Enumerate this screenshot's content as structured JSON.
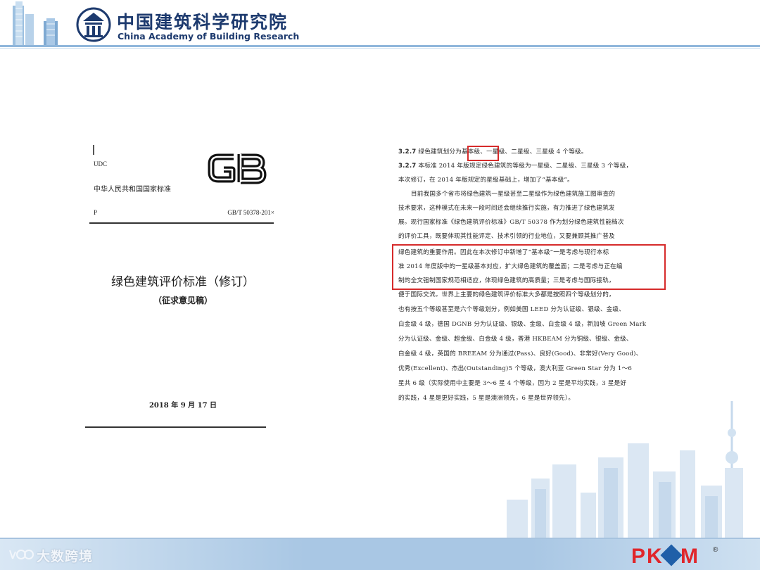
{
  "header": {
    "org_name_cn": "中国建筑科学研究院",
    "org_name_en": "China Academy of Building Research"
  },
  "cover": {
    "udc": "UDC",
    "logo_text": "GB",
    "national_standard": "中华人民共和国国家标准",
    "p": "P",
    "standard_number": "GB/T 50378-201×",
    "title": "绿色建筑评价标准（修订）",
    "subtitle": "（征求意见稿）",
    "date": "2018 年 9 月 17 日"
  },
  "text_page": {
    "lines": [
      {
        "prefix": "3.2.7",
        "text": "  绿色建筑划分为基本级、一星级、二星级、三星级 4 个等级。",
        "indent": false
      },
      {
        "prefix": "3.2.7",
        "text": " 本标准 2014 年版规定绿色建筑的等级为一星级、二星级、三星级 3 个等级，",
        "indent": false
      },
      {
        "prefix": "",
        "text": "本次修订，在 2014 年版规定的星级基础上，增加了“基本级”。",
        "indent": false
      },
      {
        "prefix": "",
        "text": "目前我国多个省市将绿色建筑一星级甚至二星级作为绿色建筑施工图审查的",
        "indent": true
      },
      {
        "prefix": "",
        "text": "技术要求，这种模式在未来一段时间还会继续推行实施，有力推进了绿色建筑发",
        "indent": false
      },
      {
        "prefix": "",
        "text": "展。现行国家标准《绿色建筑评价标准》GB/T 50378 作为划分绿色建筑性能档次",
        "indent": false
      },
      {
        "prefix": "",
        "text": "的评价工具，既要体现其性能评定、技术引领的行业地位，又要兼顾其推广普及",
        "indent": false
      },
      {
        "prefix": "",
        "text": "绿色建筑的重要作用。因此在本次修订中新增了“基本级”一是考虑与现行本标",
        "indent": false
      },
      {
        "prefix": "",
        "text": "准 2014 年度版中的一星级基本对应，扩大绿色建筑的覆盖面；二是考虑与正在编",
        "indent": false
      },
      {
        "prefix": "",
        "text": "制的全文强制国家规范相适应，体现绿色建筑的高质量；三是考虑与国际接轨，",
        "indent": false
      },
      {
        "prefix": "",
        "text": "便于国际交流。世界上主要的绿色建筑评价标准大多都是按照四个等级划分的，",
        "indent": false
      },
      {
        "prefix": "",
        "text": "也有按五个等级甚至是六个等级划分，例如美国 LEED 分为认证级、银级、金级、",
        "indent": false
      },
      {
        "prefix": "",
        "text": "白金级 4 级，德国 DGNB 分为认证级、银级、金级、白金级 4 级，新加坡 Green Mark",
        "indent": false
      },
      {
        "prefix": "",
        "text": "分为认证级、金级、超金级、白金级 4 级，香港 HKBEAM 分为铜级、银级、金级、",
        "indent": false
      },
      {
        "prefix": "",
        "text": "白金级 4 级，英国的 BREEAM 分为通过(Pass)、良好(Good)、非常好(Very Good)、",
        "indent": false
      },
      {
        "prefix": "",
        "text": "优秀(Excellent)、杰出(Outstanding)5 个等级，澳大利亚 Green Star 分为 1～6",
        "indent": false
      },
      {
        "prefix": "",
        "text": "星共 6 级（实际使用中主要是 3～6 星 4 个等级，因为 2 星是平均实践，3 星是好",
        "indent": false
      },
      {
        "prefix": "",
        "text": "的实践，4 星是更好实践，5 星是澳洲领先，6 星是世界领先）。",
        "indent": false
      }
    ]
  },
  "footer": {
    "watermark": "大数跨境",
    "brand": "PKPM",
    "brand_mark": "®"
  },
  "colors": {
    "header_blue": "#1d3a6e",
    "highlight_red": "#d62b2b",
    "pkpm_red": "#e0262b",
    "pkpm_blue": "#1f5fa8"
  }
}
